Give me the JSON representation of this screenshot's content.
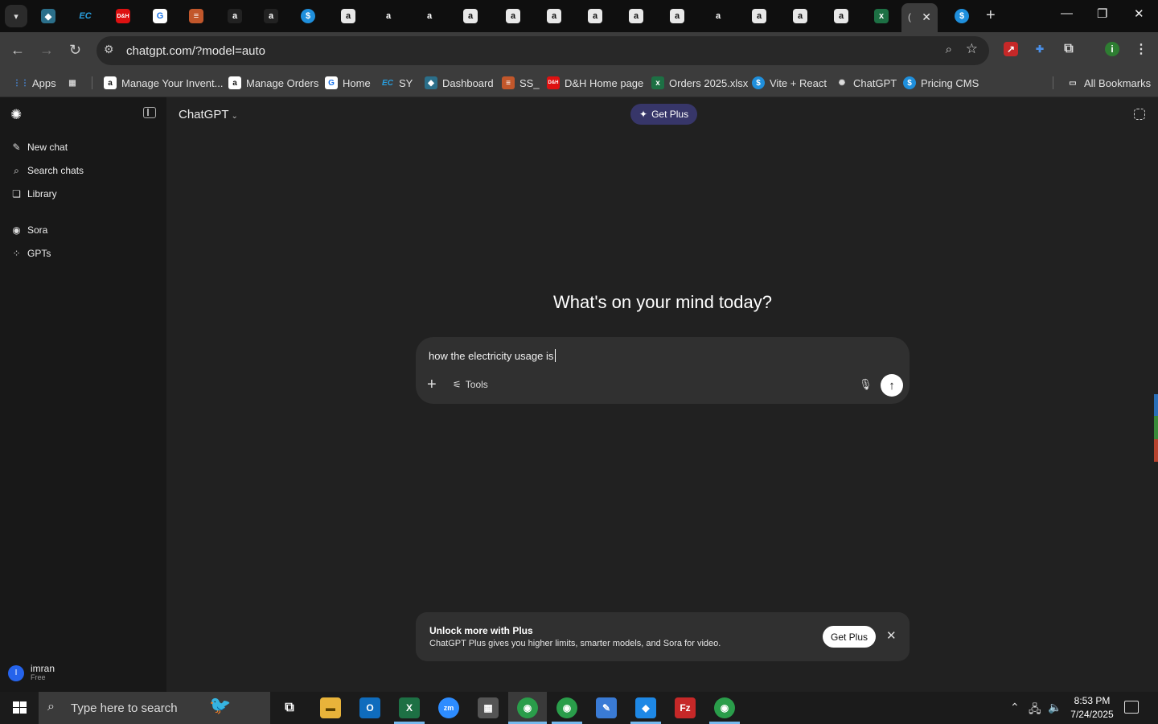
{
  "browser": {
    "url": "chatgpt.com/?model=auto",
    "bookmarks": [
      {
        "label": "Apps",
        "icon": "apps-grid-icon"
      },
      {
        "label": "",
        "icon": "tab-groups-icon"
      },
      {
        "label": "Manage Your Invent...",
        "icon": "amazon-icon"
      },
      {
        "label": "Manage Orders",
        "icon": "amazon-icon"
      },
      {
        "label": "Home",
        "icon": "home-app-icon"
      },
      {
        "label": "SY",
        "icon": "ec-icon"
      },
      {
        "label": "Dashboard",
        "icon": "dashboard-app-icon"
      },
      {
        "label": "SS_",
        "icon": "ss-app-icon"
      },
      {
        "label": "D&H Home page",
        "icon": "dh-icon"
      },
      {
        "label": "Orders 2025.xlsx",
        "icon": "excel-icon"
      },
      {
        "label": "Vite + React",
        "icon": "dollar-icon"
      },
      {
        "label": "ChatGPT",
        "icon": "openai-icon"
      },
      {
        "label": "Pricing CMS",
        "icon": "dollar-icon"
      }
    ],
    "all_bookmarks": "All Bookmarks",
    "profile_initial": "i"
  },
  "sidebar": {
    "items": [
      {
        "label": "New chat",
        "icon": "edit-icon"
      },
      {
        "label": "Search chats",
        "icon": "search-icon"
      },
      {
        "label": "Library",
        "icon": "library-icon"
      },
      {
        "label": "Sora",
        "icon": "play-circle-icon"
      },
      {
        "label": "GPTs",
        "icon": "grid-icon"
      }
    ],
    "user": {
      "name": "imran",
      "plan": "Free",
      "initial": "I"
    }
  },
  "main": {
    "model_label": "ChatGPT",
    "get_plus_top": "Get Plus",
    "headline": "What's on your mind today?",
    "composer_text": "how the electricity usage is",
    "tools_label": "Tools",
    "banner": {
      "title": "Unlock more with Plus",
      "body": "ChatGPT Plus gives you higher limits, smarter models, and Sora for video.",
      "button": "Get Plus"
    }
  },
  "taskbar": {
    "search_placeholder": "Type here to search",
    "time": "8:53 PM",
    "date": "7/24/2025"
  },
  "colors": {
    "background": "#212121",
    "sidebar": "#181818",
    "composer": "#303030",
    "get_plus_accent": "#373669"
  }
}
